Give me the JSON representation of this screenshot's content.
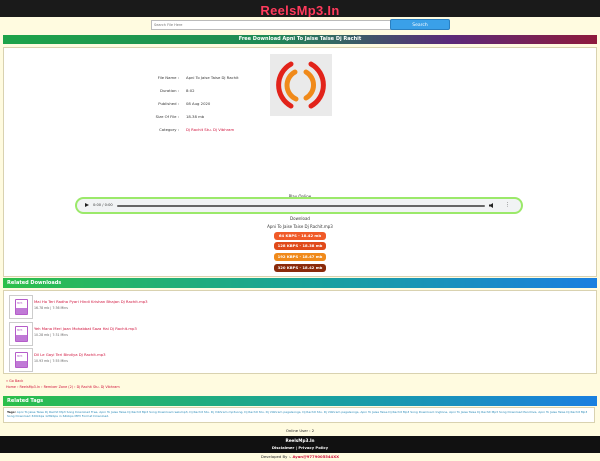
{
  "site": {
    "logo": "ReelsMp3.In"
  },
  "search": {
    "placeholder": "Search File Here",
    "button": "Search"
  },
  "page_title": "Free Download Apni To Jaise Taise Dj Rachit",
  "song": {
    "rows": [
      {
        "key": "File Name :",
        "value": "Apni To Jaise Taise Dj Rachit"
      },
      {
        "key": "Duration :",
        "value": "8:02"
      },
      {
        "key": "Published :",
        "value": "08 Aug 2020"
      },
      {
        "key": "Size Of File :",
        "value": "18.38 mb"
      },
      {
        "key": "Category :",
        "value": "Dj Rachit Stu. Dj Vibhram"
      }
    ]
  },
  "player": {
    "label": "Play Online",
    "time": "0:00 / 0:00"
  },
  "download": {
    "label": "Download",
    "filename": "Apni To Jaise Taise Dj Rachit.mp3",
    "buttons": [
      {
        "label": "64 KBPS - 18.42 mb",
        "color": "#f05a28"
      },
      {
        "label": "128 KBPS - 18.38 mb",
        "color": "#e04a1a"
      },
      {
        "label": "192 KBPS - 18.47 mb",
        "color": "#f08a1a"
      },
      {
        "label": "320 KBPS - 18.42 mb",
        "color": "#8a2a0a"
      }
    ]
  },
  "related_downloads": {
    "heading": "Related Downloads",
    "items": [
      {
        "title": "Mai Ho Teri Radha Pyari Hindi Krishan Bhajan Dj Rachit.mp3",
        "meta": "16.78 mb | 7:36 Mins"
      },
      {
        "title": "Yeh Mana Meri Jaan Mohabbat Saza Hai Dj Rachit.mp3",
        "meta": "10.28 mb | 7:31 Mins"
      },
      {
        "title": "Dil Le Gayi Teri Bindiya Dj Rachit.mp3",
        "meta": "10.93 mb | 7:55 Mins"
      }
    ],
    "icon_text": "MP3"
  },
  "breadcrumb": {
    "back": "« Go Back",
    "path": "Home › ReelsMp3.In › Remixer Zone (2) › Dj Rachit Stu. Dj Vibhram"
  },
  "related_tags": {
    "heading": "Related Tags",
    "label": "Tags:",
    "text": "Apni To Jaise Taise Dj Rachit Mp3 Song Download Free, Apni To Jaise Taise Dj Rachit Mp3 Song Download reelsmp3, Dj Rachit Stu. Dj Vibhram mp3song, Dj Rachit Stu. Dj Vibhram pagalsongs, Dj Rachit Stu. Dj Vibhram pagalsongs, Apni To Jaise Taise Dj Rachit Mp3 Song Download ringtone, Apni To Jaise Taise Dj Rachit Mp3 Song Download Pendrive, Apni To Jaise Taise Dj Rachit Mp3 Song Download 320kbps 128kbps in 64kbps MP3 Format Download."
  },
  "online": "Online User : 2",
  "footer": {
    "site": "ReelsMp3.In",
    "links": "Disclaimer | Privacy Policy"
  },
  "developer": {
    "prefix": "Developed By :-",
    "name": "Ayan@9779005544XX"
  }
}
